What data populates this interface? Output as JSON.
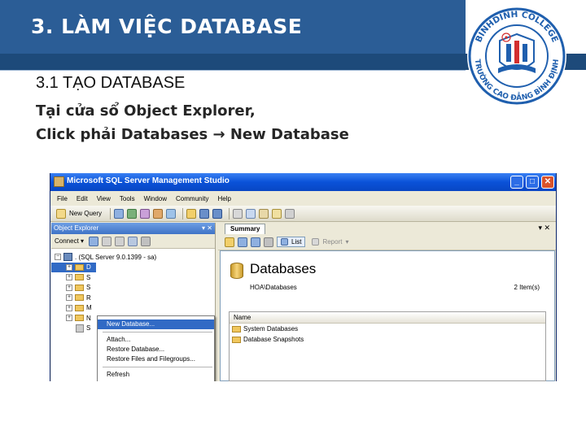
{
  "slide": {
    "title": "3. LÀM VIỆC DATABASE",
    "subheading": "3.1 TẠO DATABASE",
    "line1": "Tại cửa sổ Object Explorer,",
    "line2": "Click phải Databases → New Database"
  },
  "logo": {
    "top_text": "BINHDINH COLLEGE",
    "bottom_text": "TRƯỜNG CAO ĐẲNG BÌNH ĐỊNH"
  },
  "window": {
    "title": "Microsoft SQL Server Management Studio",
    "controls": [
      "_",
      "□",
      "✕"
    ],
    "menu": [
      "File",
      "Edit",
      "View",
      "Tools",
      "Window",
      "Community",
      "Help"
    ],
    "toolbar_new_query": "New Query"
  },
  "object_explorer": {
    "header": "Object Explorer",
    "header_btns": "▾ ✕",
    "connect": "Connect ▾",
    "server_node": ". (SQL Server 9.0.1399 - sa)",
    "tree_letters": [
      "D",
      "S",
      "S",
      "R",
      "M",
      "N",
      "S"
    ]
  },
  "context_menu": {
    "items": [
      "New Database...",
      "Attach...",
      "Restore Database...",
      "Restore Files and Filegroups...",
      "Refresh"
    ]
  },
  "summary": {
    "tab": "Summary",
    "close": "▾ ✕",
    "list_btn": "List",
    "report_btn": "Report",
    "heading": "Databases",
    "path": "HOA\\Databases",
    "count": "2 Item(s)",
    "column_name": "Name",
    "rows": [
      "System Databases",
      "Database Snapshots"
    ]
  }
}
